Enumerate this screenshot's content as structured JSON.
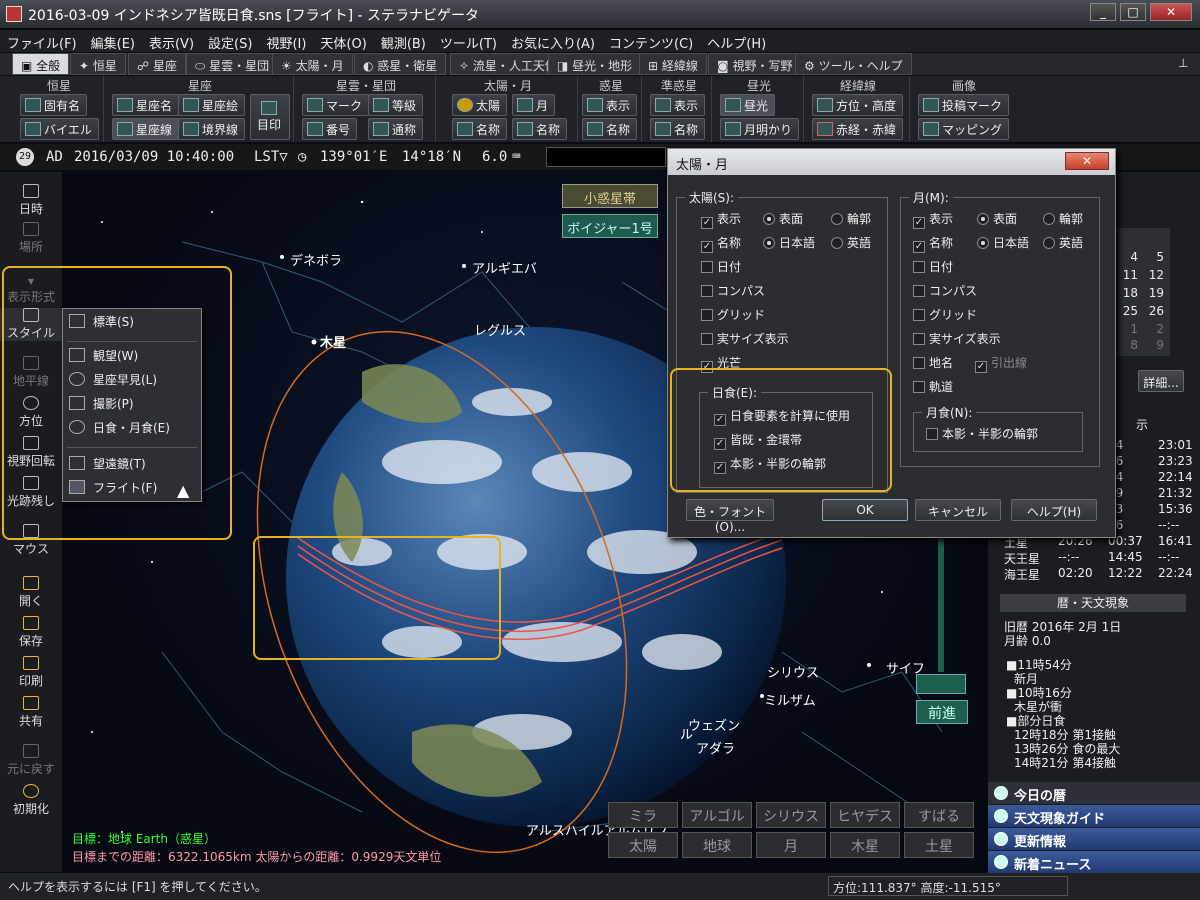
{
  "window": {
    "title": "2016-03-09 インドネシア皆既日食.sns [フライト] - ステラナビゲータ",
    "min": "_",
    "max": "□",
    "close": "✕"
  },
  "menu": [
    "ファイル(F)",
    "編集(E)",
    "表示(V)",
    "設定(S)",
    "視野(I)",
    "天体(O)",
    "観測(B)",
    "ツール(T)",
    "お気に入り(A)",
    "コンテンツ(C)",
    "ヘルプ(H)"
  ],
  "tabs": [
    "全般",
    "恒星",
    "星座",
    "星雲・星団",
    "太陽・月",
    "惑星・衛星",
    "流星・人工天体",
    "昼光・地形",
    "経緯線",
    "視野・写野",
    "ツール・ヘルプ"
  ],
  "ribbon": {
    "groups": [
      "恒星",
      "星座",
      "星雲・星団",
      "太陽・月",
      "惑星",
      "準惑星",
      "昼光",
      "経緯線",
      "画像"
    ],
    "star_name": "固有名",
    "bayer": "バイエル",
    "const_name": "星座名",
    "const_art": "星座絵",
    "const_line": "星座線",
    "boundary": "境界線",
    "marker": "目印",
    "neb_mark": "マーク",
    "neb_mag": "等級",
    "neb_num": "番号",
    "neb_common": "通称",
    "sun": "太陽",
    "moon": "月",
    "sun_name": "名称",
    "moon_name": "名称",
    "planet_show": "表示",
    "planet_name": "名称",
    "dwarf_show": "表示",
    "dwarf_name": "名称",
    "daylight": "昼光",
    "moonlight": "月明かり",
    "altaz": "方位・高度",
    "radec": "赤経・赤緯",
    "projmark": "投稿マーク",
    "mapping": "マッピング"
  },
  "coords": {
    "era": "AD",
    "datetime": "2016/03/09 10:40:00",
    "time_type": "LST▽",
    "lon": "139°01′E",
    "lat": "14°18′N",
    "zoom": "6.0"
  },
  "left": {
    "date": "日時",
    "place": "場所",
    "display_header": "表示形式",
    "style": "スタイル",
    "horizon": "地平線",
    "direction": "方位",
    "rotate": "視野回転",
    "trail": "光跡残し",
    "mouse": "マウス",
    "open": "開く",
    "save": "保存",
    "print": "印刷",
    "share": "共有",
    "undo": "元に戻す",
    "reset": "初期化"
  },
  "style_menu": [
    "標準(S)",
    "観望(W)",
    "星座早見(L)",
    "撮影(P)",
    "日食・月食(E)",
    "望遠鏡(T)",
    "フライト(F)"
  ],
  "sky": {
    "labels": {
      "deneb": "デネボラ",
      "algieba": "アルギエバ",
      "jupiter": "木星",
      "regulus": "レグルス",
      "sirius": "シリウス",
      "mirzam": "ミルザム",
      "saiph": "サイフ",
      "wezen": "ウェズン",
      "adhara": "アダラ",
      "alshain": "アルスハイルアルムリフ",
      "ru": "ル"
    },
    "asteroid_btn": "小惑星帯",
    "voyager_btn": "ボイジャー1号",
    "forward": "前進",
    "target": "目標：地球 Earth（惑星）",
    "distance": "目標までの距離：6322.1065km  太陽からの距離：0.9929天文単位",
    "quick": [
      "ミラ",
      "アルゴル",
      "シリウス",
      "ヒヤデス",
      "すばる",
      "太陽",
      "地球",
      "月",
      "木星",
      "土星"
    ]
  },
  "dialog": {
    "title": "太陽・月",
    "close": "✕",
    "sun_group": "太陽(S):",
    "moon_group": "月(M):",
    "show": "表示",
    "surface": "表面",
    "ring": "輪郭",
    "name": "名称",
    "japanese": "日本語",
    "english": "英語",
    "sun_opts": [
      "日付",
      "コンパス",
      "グリッド",
      "実サイズ表示",
      "光芒"
    ],
    "moon_opts": [
      "日付",
      "コンパス",
      "グリッド",
      "実サイズ表示",
      "地名"
    ],
    "leader": "引出線",
    "orbit": "軌道",
    "eclipse_group": "日食(E):",
    "eclipse_opts": [
      "日食要素を計算に使用",
      "皆既・金環帯",
      "本影・半影の輪郭"
    ],
    "lunar_group": "月食(N):",
    "lunar_opt": "本影・半影の輪郭",
    "color_font": "色・フォント(O)...",
    "ok": "OK",
    "cancel": "キャンセル",
    "help": "ヘルプ(H)"
  },
  "right": {
    "cal_rows": [
      [
        "4",
        "5"
      ],
      [
        "11",
        "12"
      ],
      [
        "18",
        "19"
      ],
      [
        "25",
        "26"
      ],
      [
        "1",
        "2"
      ],
      [
        "8",
        "9"
      ]
    ],
    "detail": "詳細...",
    "show": "示",
    "times": [
      [
        "54",
        "23:01"
      ],
      [
        "56",
        "23:23"
      ],
      [
        "24",
        "22:14"
      ],
      [
        "29",
        "21:32"
      ],
      [
        "33",
        "15:36"
      ],
      [
        "56",
        "--:--"
      ]
    ],
    "planets": [
      [
        "土星",
        "20:26",
        "00:37",
        "16:41"
      ],
      [
        "天王星",
        "--:--",
        "14:45",
        "--:--"
      ],
      [
        "海王星",
        "02:20",
        "12:22",
        "22:24"
      ]
    ],
    "almanac_head": "暦・天文現象",
    "lunar_date": "旧暦 2016年 2月 1日",
    "moon_age": "月齢 0.0",
    "events": [
      "■11時54分",
      "新月",
      "■10時16分",
      "木星が衝",
      "■部分日食",
      "12時18分 第1接触",
      "13時26分 食の最大",
      "14時21分 第4接触"
    ],
    "nav": [
      "今日の暦",
      "天文現象ガイド",
      "更新情報",
      "新着ニュース"
    ]
  },
  "status": {
    "help": "ヘルプを表示するには [F1] を押してください。",
    "position": "方位:111.837°  高度:-11.515°"
  }
}
